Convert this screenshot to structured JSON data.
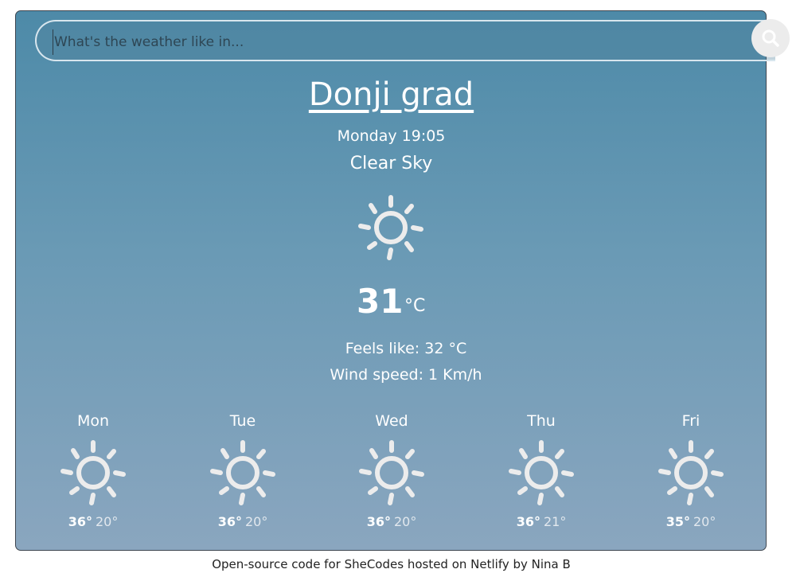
{
  "search": {
    "placeholder": "What's the weather like in..."
  },
  "current": {
    "city": "Donji grad",
    "datetime": "Monday 19:05",
    "description": "Clear Sky",
    "icon": "sun-icon",
    "temperature": "31",
    "unit": "°C",
    "feels_like": "Feels like: 32 °C",
    "wind": "Wind speed: 1 Km/h"
  },
  "forecast": [
    {
      "day": "Mon",
      "icon": "sun-icon",
      "max": "36°",
      "min": "20°"
    },
    {
      "day": "Tue",
      "icon": "sun-icon",
      "max": "36°",
      "min": "20°"
    },
    {
      "day": "Wed",
      "icon": "sun-icon",
      "max": "36°",
      "min": "20°"
    },
    {
      "day": "Thu",
      "icon": "sun-icon",
      "max": "36°",
      "min": "21°"
    },
    {
      "day": "Fri",
      "icon": "sun-icon",
      "max": "35°",
      "min": "20°"
    }
  ],
  "footer": {
    "text": "Open-source code for SheCodes hosted on Netlify by Nina B"
  },
  "colors": {
    "accent": "#4d8aa8",
    "icon": "#ececec"
  }
}
